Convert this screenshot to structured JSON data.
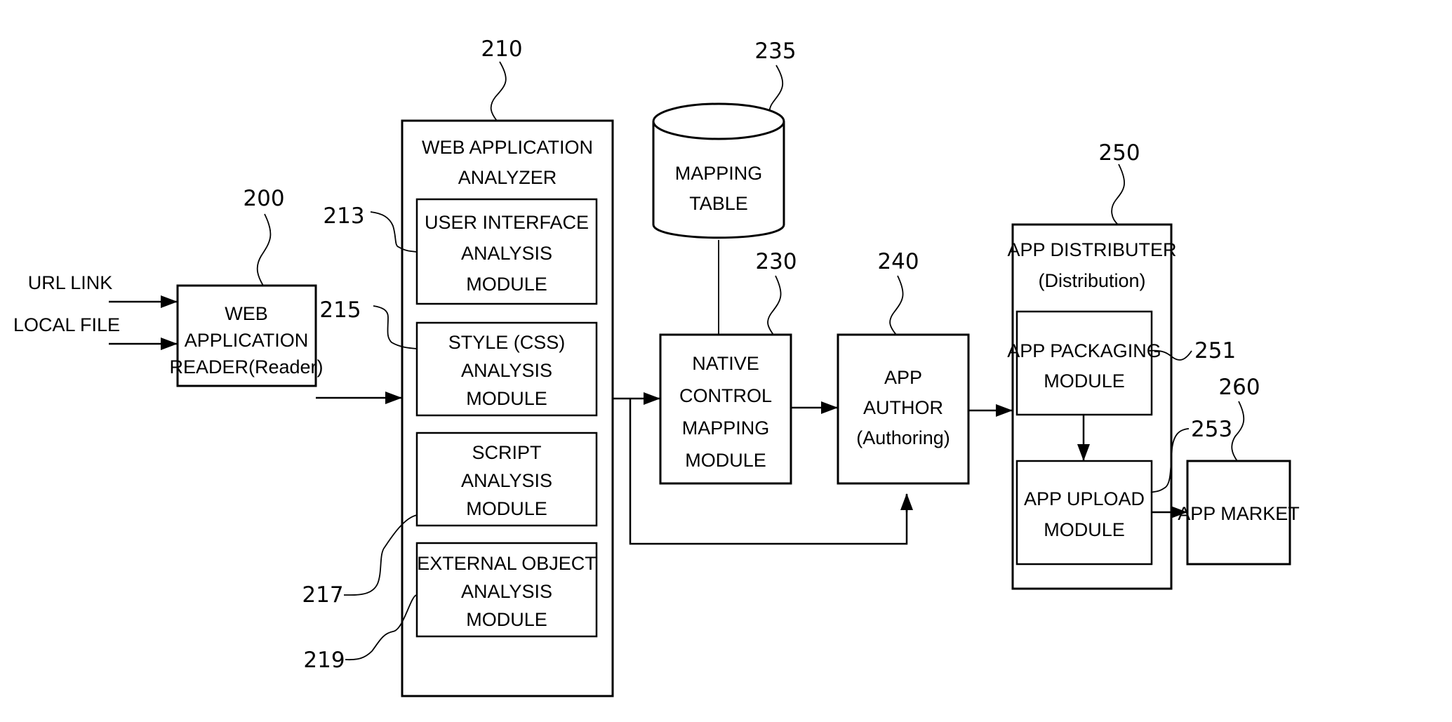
{
  "diagram": {
    "inputs": {
      "url_link": "URL LINK",
      "local_file": "LOCAL FILE"
    },
    "reader": {
      "ref": "200",
      "lines": [
        "WEB",
        "APPLICATION",
        "READER(Reader)"
      ]
    },
    "analyzer": {
      "ref": "210",
      "title_lines": [
        "WEB APPLICATION",
        "ANALYZER"
      ],
      "modules": [
        {
          "ref": "213",
          "lines": [
            "USER INTERFACE",
            "ANALYSIS",
            "MODULE"
          ]
        },
        {
          "ref": "215",
          "lines": [
            "STYLE (CSS)",
            "ANALYSIS",
            "MODULE"
          ]
        },
        {
          "ref": "217",
          "lines": [
            "SCRIPT",
            "ANALYSIS",
            "MODULE"
          ]
        },
        {
          "ref": "219",
          "lines": [
            "EXTERNAL OBJECT",
            "ANALYSIS",
            "MODULE"
          ]
        }
      ]
    },
    "mapping_table": {
      "ref": "235",
      "lines": [
        "MAPPING",
        "TABLE"
      ]
    },
    "native_control": {
      "ref": "230",
      "lines": [
        "NATIVE",
        "CONTROL",
        "MAPPING",
        "MODULE"
      ]
    },
    "app_author": {
      "ref": "240",
      "lines": [
        "APP",
        "AUTHOR",
        "(Authoring)"
      ]
    },
    "distributer": {
      "ref": "250",
      "title_lines": [
        "APP DISTRIBUTER",
        "(Distribution)"
      ],
      "packaging": {
        "ref": "251",
        "lines": [
          "APP PACKAGING",
          "MODULE"
        ]
      },
      "upload": {
        "ref": "253",
        "lines": [
          "APP UPLOAD",
          "MODULE"
        ]
      }
    },
    "market": {
      "ref": "260",
      "lines": [
        "APP MARKET"
      ]
    }
  }
}
